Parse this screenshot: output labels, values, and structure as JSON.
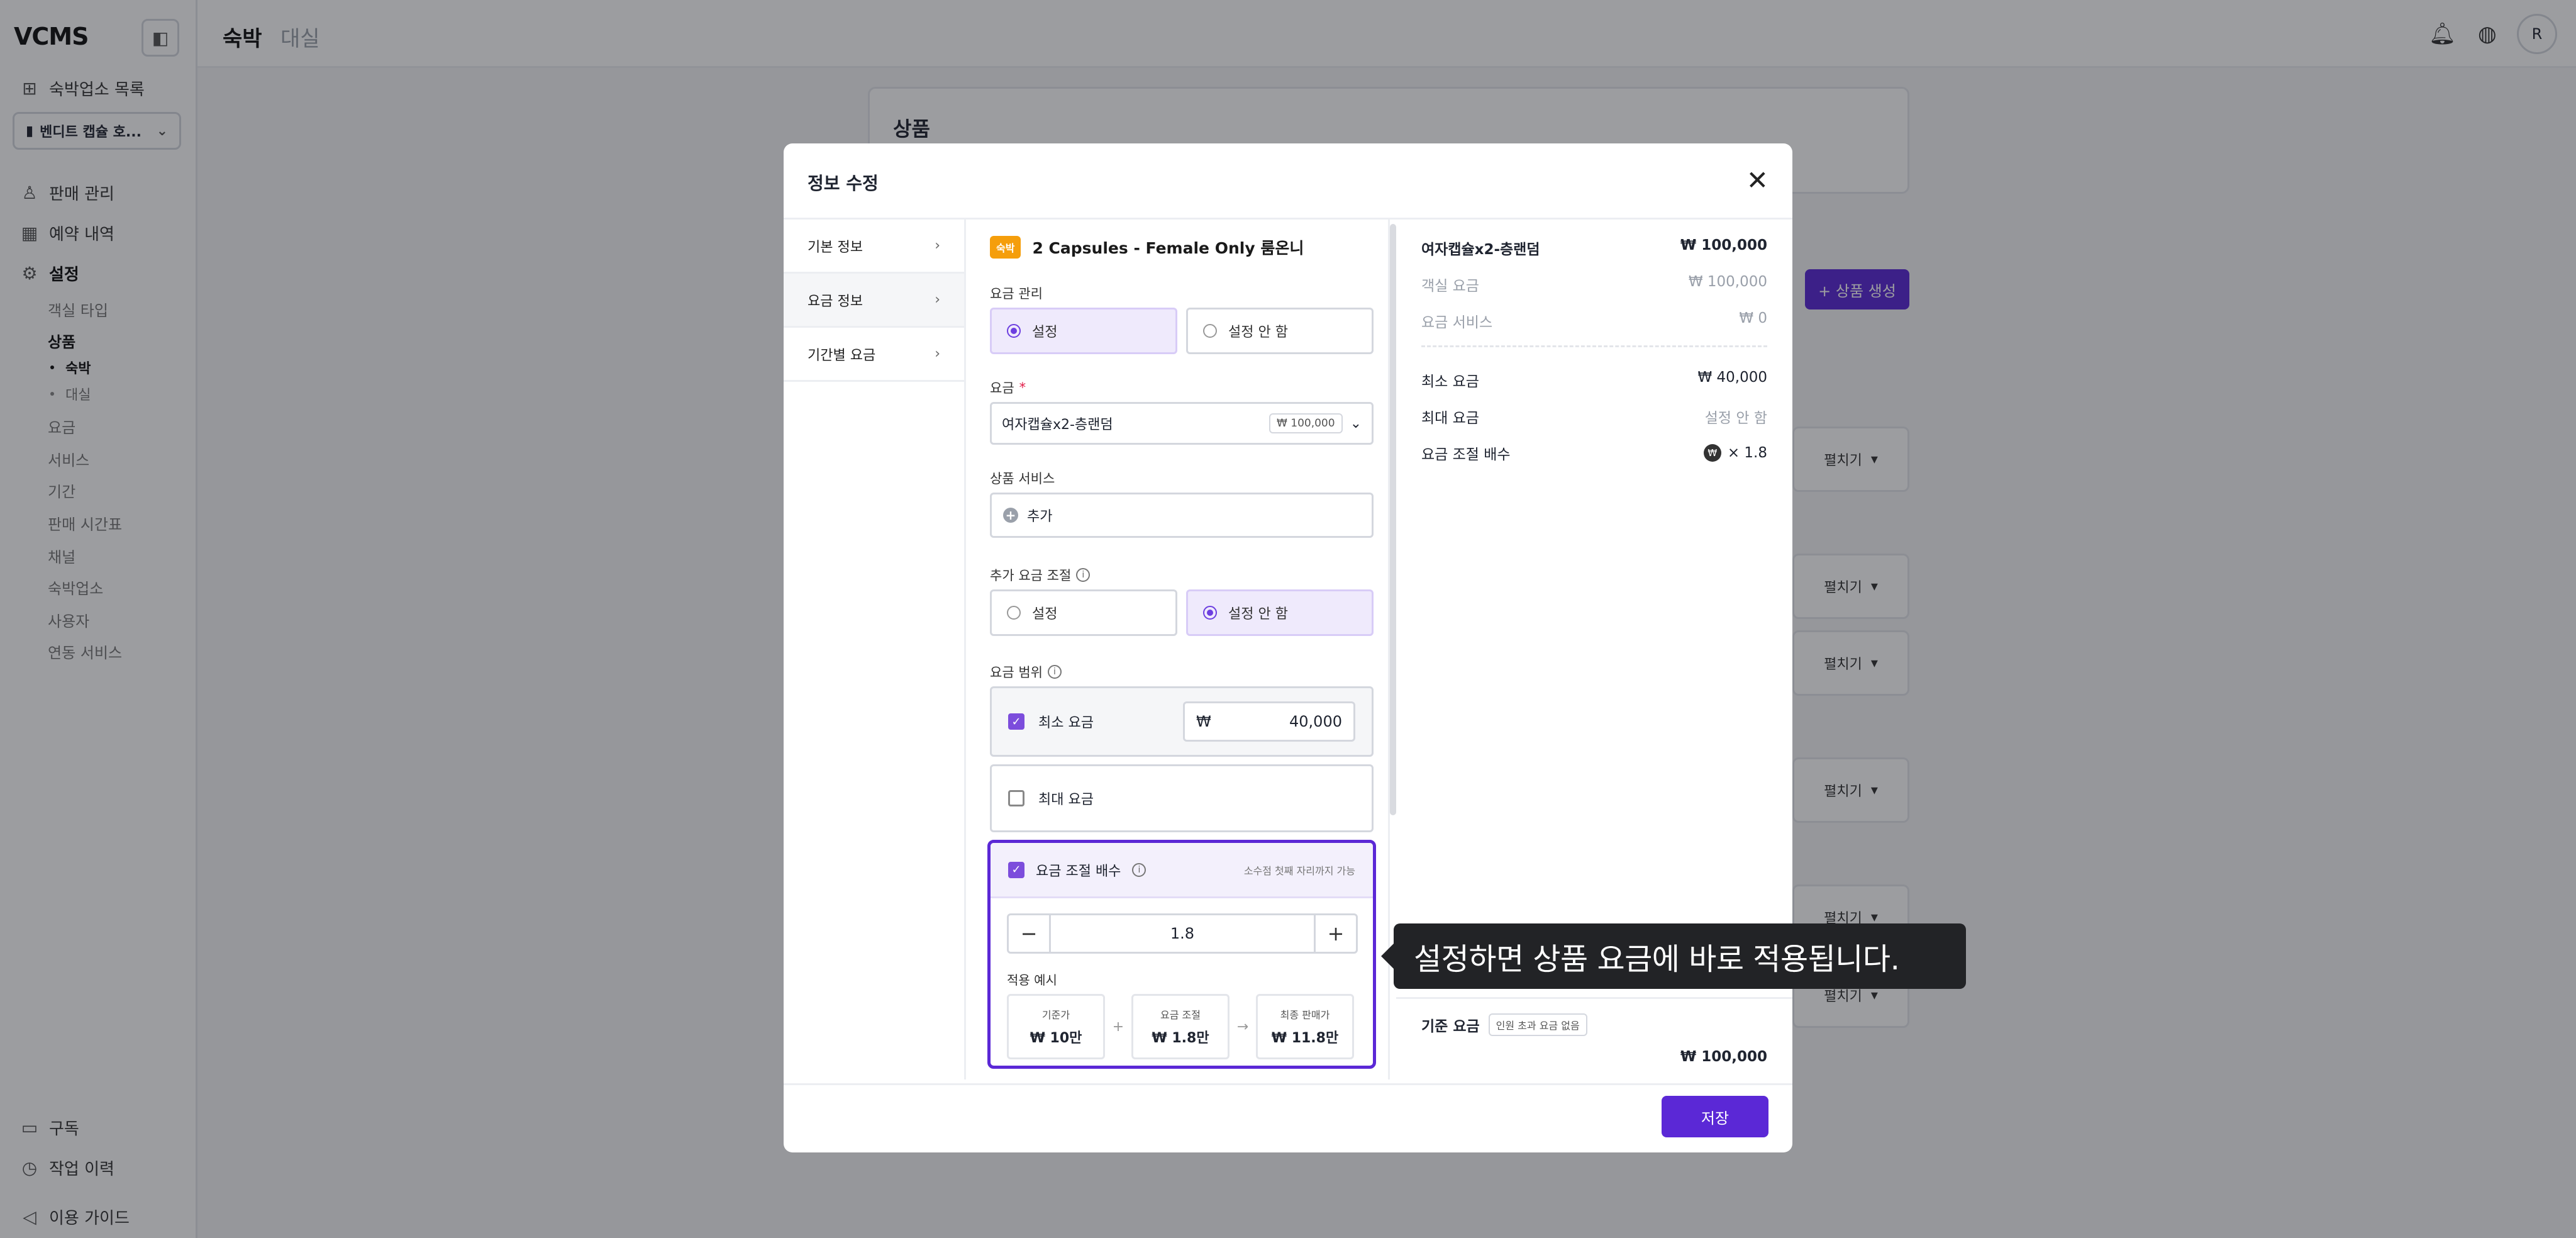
{
  "app": {
    "logo": "VCMS"
  },
  "sidebar": {
    "property_list": "숙박업소 목록",
    "selected_property": "벤디트 캡슐 호...",
    "sales": "판매 관리",
    "reservations": "예약 내역",
    "settings": "설정",
    "settings_items": {
      "room_type": "객실 타입",
      "product": "상품",
      "stay": "숙박",
      "rental": "대실",
      "rate": "요금",
      "service": "서비스",
      "period": "기간",
      "sales_schedule": "판매 시간표",
      "channel": "채널",
      "property": "숙박업소",
      "user": "사용자",
      "integration": "연동 서비스"
    },
    "subscription": "구독",
    "history": "작업 이력",
    "guide": "이용 가이드"
  },
  "header": {
    "tab_stay": "숙박",
    "tab_rental": "대실",
    "avatar": "R"
  },
  "background": {
    "title": "상품",
    "create_button": "+ 상품 생성",
    "expand": "펼치기"
  },
  "modal": {
    "title": "정보 수정",
    "nav": [
      "기본 정보",
      "요금 정보",
      "기간별 요금"
    ],
    "badge": "숙박",
    "product_title": "2 Capsules - Female Only 룸온니",
    "rate_mgmt": {
      "label": "요금 관리",
      "on": "설정",
      "off": "설정 안 함"
    },
    "rate": {
      "label": "요금",
      "required": "*",
      "value": "여자캡슐x2-층랜덤",
      "chip": "₩ 100,000"
    },
    "product_service": {
      "label": "상품 서비스",
      "add": "추가"
    },
    "extra_adjust": {
      "label": "추가 요금 조절",
      "on": "설정",
      "off": "설정 안 함"
    },
    "rate_range": {
      "label": "요금 범위",
      "min_label": "최소 요금",
      "currency": "₩",
      "min_value": "40,000",
      "max_label": "최대 요금"
    },
    "multiplier": {
      "label": "요금 조절 배수",
      "hint": "소수점 첫째 자리까지 가능",
      "minus": "−",
      "value": "1.8",
      "plus": "+",
      "example_label": "적용 예시",
      "ex_base_l": "기준가",
      "ex_base_v": "₩ 10만",
      "ex_adj_l": "요금 조절",
      "ex_adj_v": "₩ 1.8만",
      "ex_final_l": "최종 판매가",
      "ex_final_v": "₩ 11.8만",
      "op_plus": "+",
      "op_arrow": "→"
    },
    "summary": {
      "name": "여자캡슐x2-층랜덤",
      "total": "₩ 100,000",
      "room_rate_l": "객실 요금",
      "room_rate_v": "₩ 100,000",
      "service_l": "요금 서비스",
      "service_v": "₩ 0",
      "min_l": "최소 요금",
      "min_v": "₩ 40,000",
      "max_l": "최대 요금",
      "max_v": "설정 안 함",
      "mult_l": "요금 조절 배수",
      "mult_v": "× 1.8",
      "base_l": "기준 요금",
      "base_tag": "인원 초과 요금 없음",
      "base_v": "₩ 100,000"
    },
    "save": "저장"
  },
  "tooltip": "설정하면 상품 요금에 바로 적용됩니다."
}
